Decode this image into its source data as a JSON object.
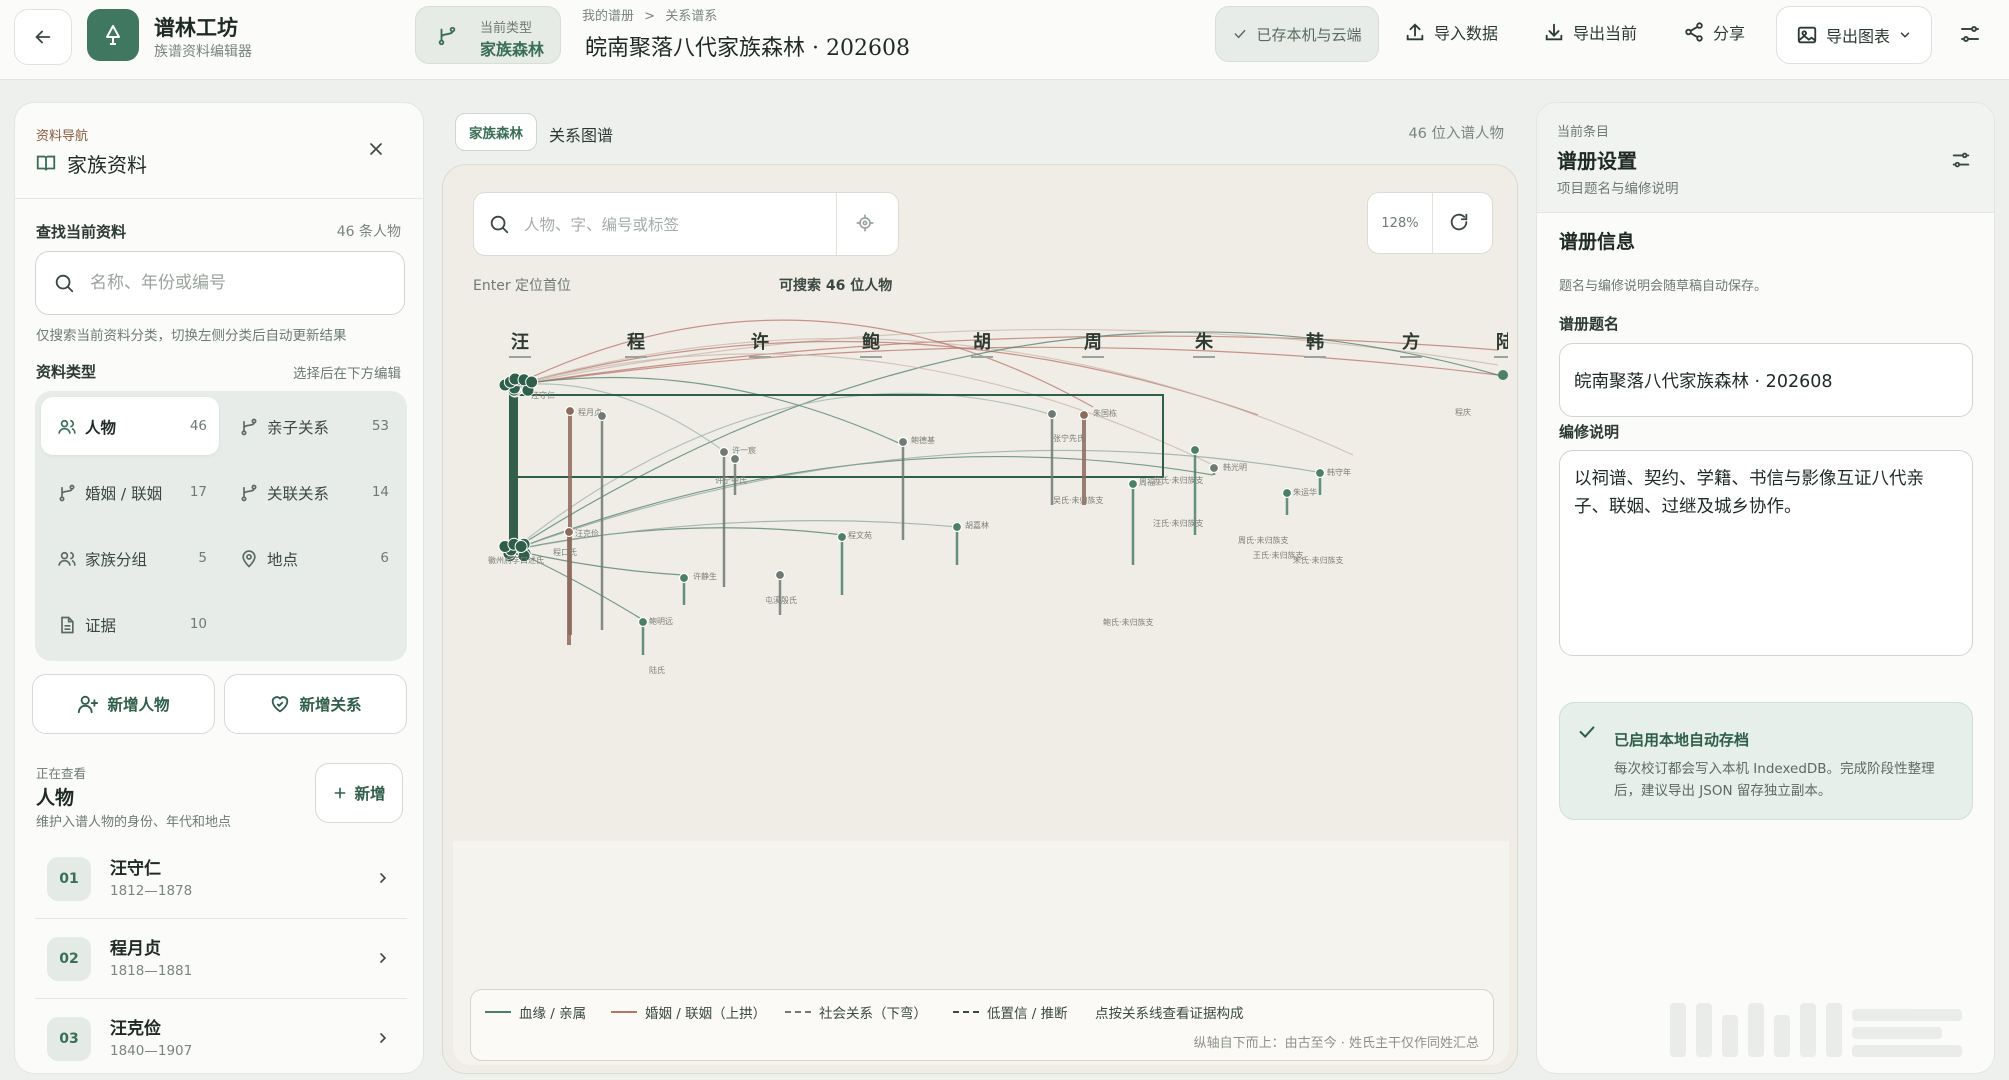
{
  "topbar": {
    "app_name": "谱林工坊",
    "app_sub": "族谱资料编辑器",
    "type_label": "当前类型",
    "type_value": "家族森林",
    "breadcrumb": [
      "我的谱册",
      ">",
      "关系谱系"
    ],
    "doc_title": "皖南聚落八代家族森林 · 202608",
    "saved_status": "已存本机与云端",
    "import_label": "导入数据",
    "export_current_label": "导出当前",
    "share_label": "分享",
    "export_chart_label": "导出图表"
  },
  "left": {
    "kicker": "资料导航",
    "title": "家族资料",
    "search_label": "查找当前资料",
    "search_count": "46 条人物",
    "search_placeholder": "名称、年份或编号",
    "search_hint": "仅搜索当前资料分类，切换左侧分类后自动更新结果",
    "cat_label": "资料类型",
    "cat_hint": "选择后在下方编辑",
    "categories": [
      {
        "label": "人物",
        "count": "46",
        "icon": "people-icon"
      },
      {
        "label": "亲子关系",
        "count": "53",
        "icon": "branch-icon"
      },
      {
        "label": "婚姻 / 联姻",
        "count": "17",
        "icon": "branch-icon"
      },
      {
        "label": "关联关系",
        "count": "14",
        "icon": "branch-icon"
      },
      {
        "label": "家族分组",
        "count": "5",
        "icon": "people-icon"
      },
      {
        "label": "地点",
        "count": "6",
        "icon": "pin-icon"
      },
      {
        "label": "证据",
        "count": "10",
        "icon": "doc-icon"
      }
    ],
    "add_person": "新增人物",
    "add_relation": "新增关系",
    "viewing_kicker": "正在查看",
    "viewing_title": "人物",
    "viewing_desc": "维护入谱人物的身份、年代和地点",
    "new_label": "新增",
    "people": [
      {
        "num": "01",
        "name": "汪守仁",
        "years": "1812—1878"
      },
      {
        "num": "02",
        "name": "程月贞",
        "years": "1818—1881"
      },
      {
        "num": "03",
        "name": "汪克俭",
        "years": "1840—1907"
      }
    ]
  },
  "center": {
    "tab_chip": "家族森林",
    "tab_text": "关系图谱",
    "people_count": "46 位入谱人物",
    "search_placeholder": "人物、字、编号或标签",
    "enter_hint": "Enter 定位首位",
    "search_count": "可搜索 46 位人物",
    "zoom": "128%",
    "surnames": [
      "汪",
      "程",
      "许",
      "鲍",
      "胡",
      "周",
      "朱",
      "韩",
      "方",
      "陆"
    ],
    "node_labels": [
      "汪守仁",
      "程月贞",
      "许一宸",
      "鲍德基",
      "朱国栋",
      "张宁先氏",
      "韩光明",
      "苏氏·未归族支",
      "汪克俭",
      "程文苑",
      "胡嘉林",
      "周福三",
      "朱运华",
      "韩守年",
      "王氏·未归族支",
      "许静生",
      "鲍明远",
      "吴氏·未归族支",
      "程庆",
      "汪氏·未归族支",
      "鲍氏·未归族支",
      "周氏·未归族支",
      "朱氏·未归族支",
      "徽州府学口述氏",
      "许宁中氏",
      "程口氏",
      "屯溪殷氏",
      "陆氏"
    ],
    "legend": [
      {
        "label": "血缘 / 亲属",
        "color": "#4c7f68",
        "style": "solid"
      },
      {
        "label": "婚姻 / 联姻（上拱）",
        "color": "#b9746a",
        "style": "solid"
      },
      {
        "label": "社会关系（下弯）",
        "color": "#6e7a73",
        "style": "dashed"
      },
      {
        "label": "低置信 / 推断",
        "color": "#3a4a42",
        "style": "dashed"
      },
      {
        "label": "点按关系线查看证据构成",
        "color": "",
        "style": "none"
      }
    ],
    "legend_footer": "纵轴自下而上：由古至今 · 姓氏主干仅作同姓汇总"
  },
  "right": {
    "kicker": "当前条目",
    "title": "谱册设置",
    "sub": "项目题名与编修说明",
    "section": "谱册信息",
    "section_desc": "题名与编修说明会随草稿自动保存。",
    "title_label": "谱册题名",
    "title_value": "皖南聚落八代家族森林 · 202608",
    "note_label": "编修说明",
    "note_value": "以祠谱、契约、学籍、书信与影像互证八代亲子、联姻、过继及城乡协作。",
    "autosave_title": "已启用本地自动存档",
    "autosave_desc": "每次校订都会写入本机 IndexedDB。完成阶段性整理后，建议导出 JSON 留存独立副本。"
  },
  "colors": {
    "accent": "#3f7760",
    "kin": "#4c7f68",
    "marriage": "#b9746a",
    "canvas": "#f0ede6"
  }
}
